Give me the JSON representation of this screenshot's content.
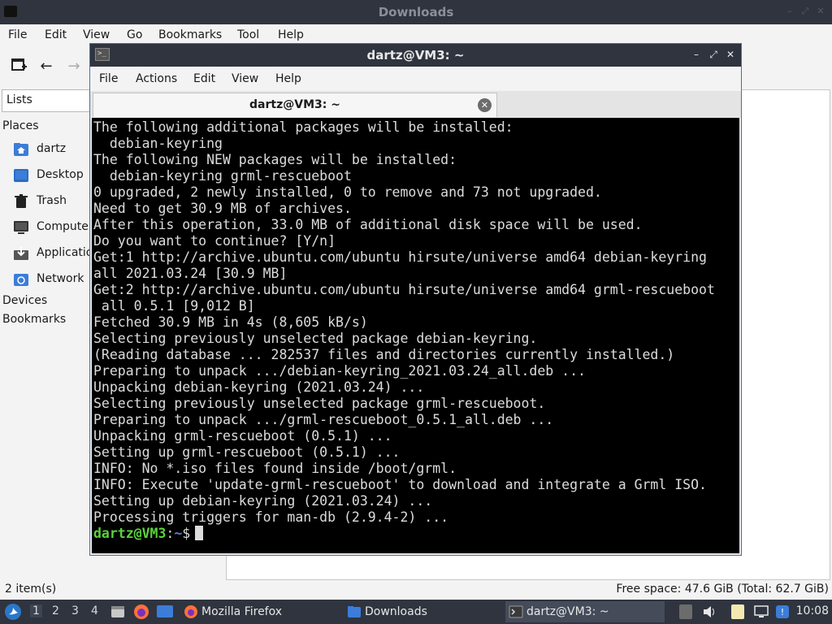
{
  "file_manager": {
    "title": "Downloads",
    "menu": [
      "File",
      "Edit",
      "View",
      "Go",
      "Bookmarks",
      "Tool",
      "Help"
    ],
    "lists_label": "Lists",
    "sidebar": {
      "places_heading": "Places",
      "places": [
        {
          "label": "dartz",
          "icon": "home-folder-icon"
        },
        {
          "label": "Desktop",
          "icon": "desktop-icon"
        },
        {
          "label": "Trash",
          "icon": "trash-icon"
        },
        {
          "label": "Computer",
          "icon": "computer-icon"
        },
        {
          "label": "Applications",
          "icon": "applications-icon"
        },
        {
          "label": "Network",
          "icon": "network-icon"
        }
      ],
      "devices_heading": "Devices",
      "bookmarks_heading": "Bookmarks"
    },
    "status_left": "2 item(s)",
    "status_right": "Free space: 47.6 GiB (Total: 62.7 GiB)"
  },
  "terminal": {
    "title": "dartz@VM3: ~",
    "menu": [
      "File",
      "Actions",
      "Edit",
      "View",
      "Help"
    ],
    "tab_label": "dartz@VM3: ~",
    "lines": [
      "The following additional packages will be installed:",
      "  debian-keyring",
      "The following NEW packages will be installed:",
      "  debian-keyring grml-rescueboot",
      "0 upgraded, 2 newly installed, 0 to remove and 73 not upgraded.",
      "Need to get 30.9 MB of archives.",
      "After this operation, 33.0 MB of additional disk space will be used.",
      "Do you want to continue? [Y/n]",
      "Get:1 http://archive.ubuntu.com/ubuntu hirsute/universe amd64 debian-keyring",
      "all 2021.03.24 [30.9 MB]",
      "Get:2 http://archive.ubuntu.com/ubuntu hirsute/universe amd64 grml-rescueboot",
      " all 0.5.1 [9,012 B]",
      "Fetched 30.9 MB in 4s (8,605 kB/s)",
      "Selecting previously unselected package debian-keyring.",
      "(Reading database ... 282537 files and directories currently installed.)",
      "Preparing to unpack .../debian-keyring_2021.03.24_all.deb ...",
      "Unpacking debian-keyring (2021.03.24) ...",
      "Selecting previously unselected package grml-rescueboot.",
      "Preparing to unpack .../grml-rescueboot_0.5.1_all.deb ...",
      "Unpacking grml-rescueboot (0.5.1) ...",
      "Setting up grml-rescueboot (0.5.1) ...",
      "INFO: No *.iso files found inside /boot/grml.",
      "INFO: Execute 'update-grml-rescueboot' to download and integrate a Grml ISO.",
      "Setting up debian-keyring (2021.03.24) ...",
      "Processing triggers for man-db (2.9.4-2) ..."
    ],
    "prompt": {
      "user_host": "dartz@VM3",
      "sep": ":",
      "path": "~",
      "sign": "$"
    }
  },
  "taskbar": {
    "workspaces": [
      "1",
      "2",
      "3",
      "4"
    ],
    "active_workspace": "1",
    "windows": [
      {
        "label": "Mozilla Firefox",
        "icon": "firefox-icon"
      },
      {
        "label": "Downloads",
        "icon": "folder-icon"
      },
      {
        "label": "dartz@VM3: ~",
        "icon": "terminal-icon"
      }
    ],
    "clock": "10:08"
  },
  "colors": {
    "titlebar": "#2f343f",
    "prompt_user": "#5ad23c",
    "prompt_path": "#5b7fe0",
    "folder_blue": "#3b7dd8"
  }
}
